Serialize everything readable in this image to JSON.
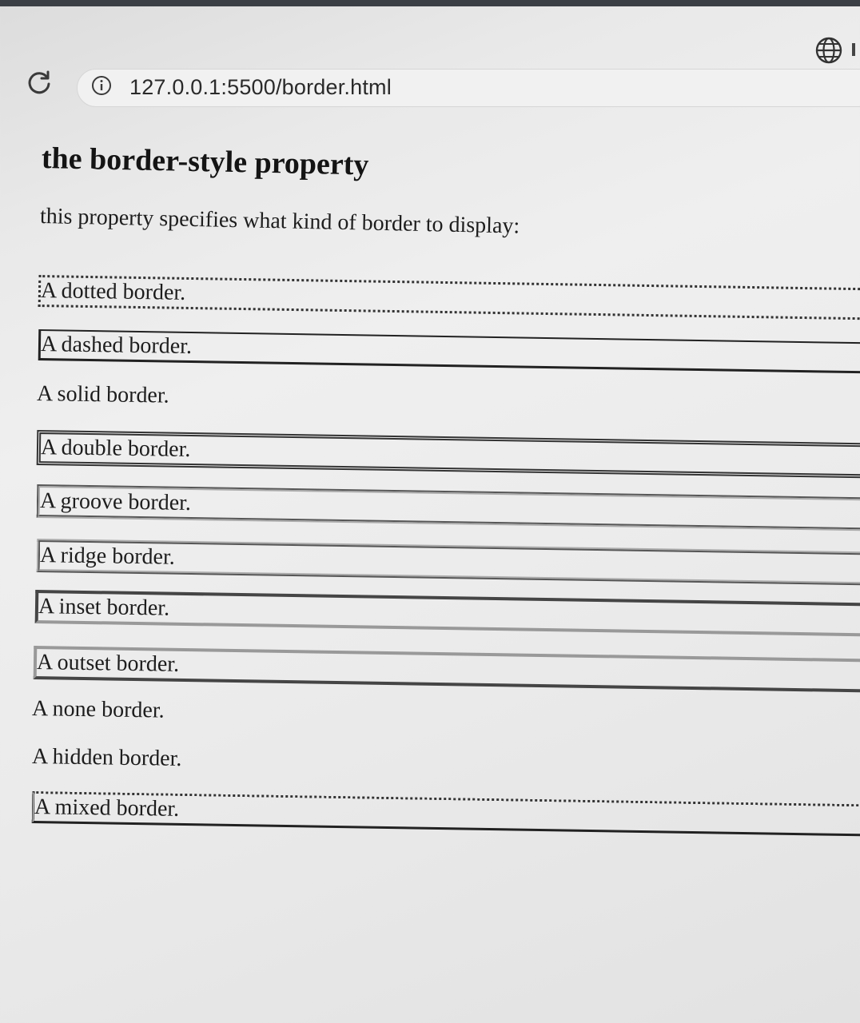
{
  "browser": {
    "url": "127.0.0.1:5500/border.html",
    "icons": {
      "reload": "reload-icon",
      "info": "info-icon",
      "globe": "globe-icon"
    }
  },
  "page": {
    "title": "the border-style property",
    "lead": "this property specifies what kind of border to display:",
    "examples": [
      "A dotted border.",
      "A dashed border.",
      "A solid border.",
      "A double border.",
      "A groove border.",
      "A ridge border.",
      "A inset border.",
      "A outset border.",
      "A none border.",
      "A hidden border.",
      "A mixed border."
    ]
  }
}
